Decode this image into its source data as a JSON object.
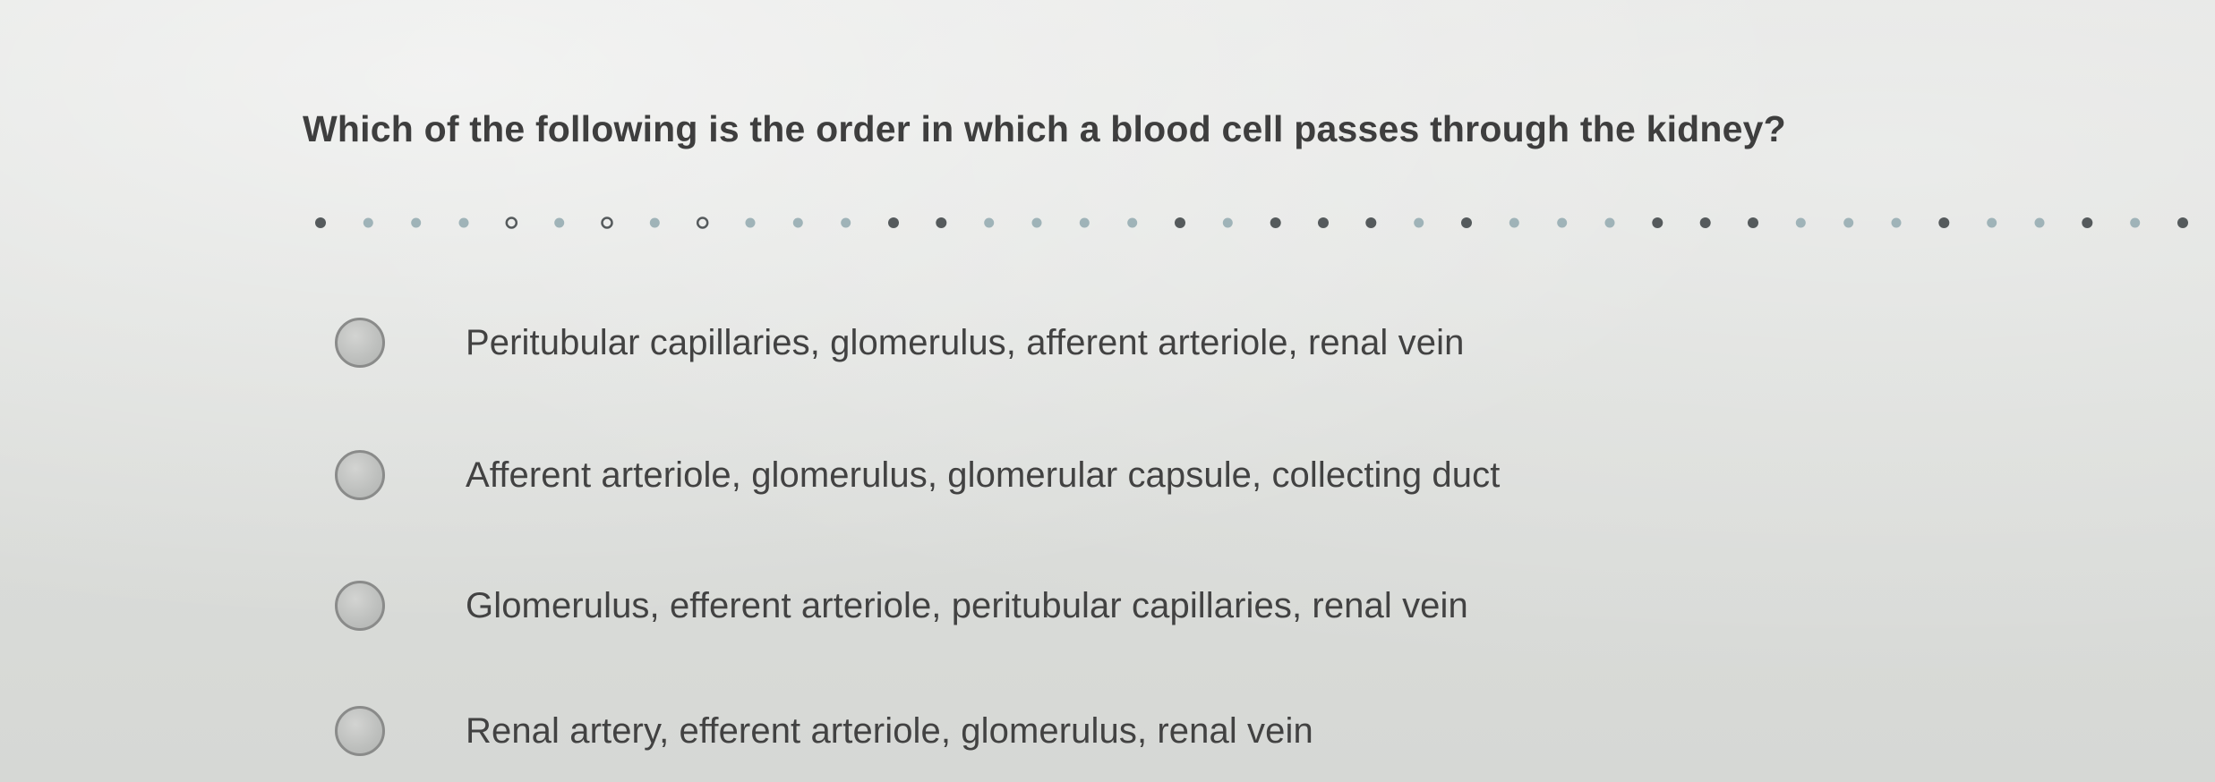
{
  "question": {
    "text": "Which of the following is the order in which a blood cell passes through the kidney?"
  },
  "options": [
    {
      "label": "Peritubular capillaries, glomerulus, afferent arteriole, renal vein",
      "selected": false
    },
    {
      "label": "Afferent arteriole, glomerulus, glomerular capsule, collecting duct",
      "selected": false
    },
    {
      "label": "Glomerulus, efferent arteriole, peritubular capillaries, renal vein",
      "selected": false
    },
    {
      "label": "Renal artery, efferent arteriole, glomerulus, renal vein",
      "selected": false
    }
  ],
  "colors": {
    "background": "#dcdedb",
    "question_text": "#3e3e3e",
    "option_text": "#424242",
    "radio_fill": "#bdbfbd",
    "radio_border": "#8a8b8a",
    "divider_dark": "#555a5c",
    "divider_light": "#9fb3b8"
  }
}
